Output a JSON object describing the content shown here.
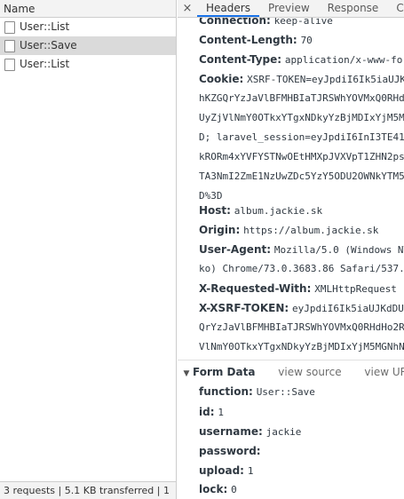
{
  "left": {
    "header": "Name",
    "requests": [
      {
        "name": "User::List",
        "selected": false
      },
      {
        "name": "User::Save",
        "selected": true
      },
      {
        "name": "User::List",
        "selected": false
      }
    ],
    "footer": "3 requests | 5.1 KB transferred | 1"
  },
  "tabs": {
    "close": "×",
    "items": [
      "Headers",
      "Preview",
      "Response",
      "Cooki"
    ]
  },
  "headers": {
    "connection": {
      "key": "Connection:",
      "value": "keep-alive"
    },
    "content_length": {
      "key": "Content-Length:",
      "value": "70"
    },
    "content_type": {
      "key": "Content-Type:",
      "value": "application/x-www-form"
    },
    "cookie": {
      "key": "Cookie:",
      "value": "XSRF-TOKEN=eyJpdiI6Ik5iaUJKc",
      "lines": [
        "hKZGQrYzJaVlBFMHBIaTJRSWhYOVMxQ0RHd",
        "UyZjVlNmY0OTkxYTgxNDkyYzBjMDIxYjM5M",
        "D; laravel_session=eyJpdiI6InI3TE41",
        "kRORm4xYVFYSTNwOEtHMXpJVXVpT1ZHN2ps",
        "TA3NmI2ZmE1NzUwZDc5YzY5ODU2OWNkYTM5",
        "D%3D"
      ]
    },
    "host": {
      "key": "Host:",
      "value": "album.jackie.sk"
    },
    "origin": {
      "key": "Origin:",
      "value": "https://album.jackie.sk"
    },
    "user_agent": {
      "key": "User-Agent:",
      "value": "Mozilla/5.0 (Windows NT",
      "lines": [
        "ko) Chrome/73.0.3683.86 Safari/537."
      ]
    },
    "x_requested_with": {
      "key": "X-Requested-With:",
      "value": "XMLHttpRequest"
    },
    "x_xsrf_token": {
      "key": "X-XSRF-TOKEN:",
      "value": "eyJpdiI6Ik5iaUJKdDUyT",
      "lines": [
        "QrYzJaVlBFMHBIaTJRSWhYOVMxQ0RHdHo2R",
        "VlNmY0OTkxYTgxNDkyYzBjMDIxYjM5MGNhN"
      ]
    }
  },
  "form_data": {
    "arrow": "▼",
    "title": "Form Data",
    "view_source": "view source",
    "view_url": "view URL en",
    "fields": [
      {
        "key": "function:",
        "value": "User::Save"
      },
      {
        "key": "id:",
        "value": "1"
      },
      {
        "key": "username:",
        "value": "jackie"
      },
      {
        "key": "password:",
        "value": ""
      },
      {
        "key": "upload:",
        "value": "1"
      },
      {
        "key": "lock:",
        "value": "0"
      }
    ]
  },
  "colors": {
    "accent": "#1a73e8",
    "selected_row": "#dadada",
    "toolbar": "#f3f3f3"
  }
}
